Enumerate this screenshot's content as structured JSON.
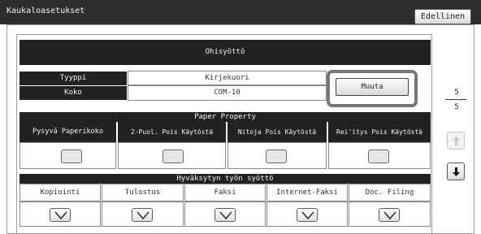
{
  "window": {
    "title": "Kaukaloasetukset",
    "back_label": "Edellinen"
  },
  "section": {
    "title": "Ohisyöttö"
  },
  "fields": [
    {
      "label": "Tyyppi",
      "value": "Kirjekuori"
    },
    {
      "label": "Koko",
      "value": "COM-10"
    }
  ],
  "change_button": "Muuta",
  "paper_property": {
    "title": "Paper Property",
    "items": [
      {
        "label": "Pysyvä Paperikoko",
        "checked": false
      },
      {
        "label": "2-Puol. Pois Käytöstä",
        "checked": false
      },
      {
        "label": "Nitoja Pois Käytöstä",
        "checked": false
      },
      {
        "label": "Rei'itys Pois Käytöstä",
        "checked": false
      }
    ]
  },
  "accepted_jobs": {
    "title": "Hyväksytyn työn syöttö",
    "items": [
      {
        "label": "Kopiointi",
        "checked": true
      },
      {
        "label": "Tulostus",
        "checked": true
      },
      {
        "label": "Faksi",
        "checked": true
      },
      {
        "label": "Internet-Faksi",
        "checked": true
      },
      {
        "label": "Doc. Filing",
        "checked": true
      }
    ]
  },
  "pager": {
    "current": "5",
    "total": "5",
    "up_icon": "arrow-up-icon",
    "down_icon": "arrow-down-icon"
  }
}
